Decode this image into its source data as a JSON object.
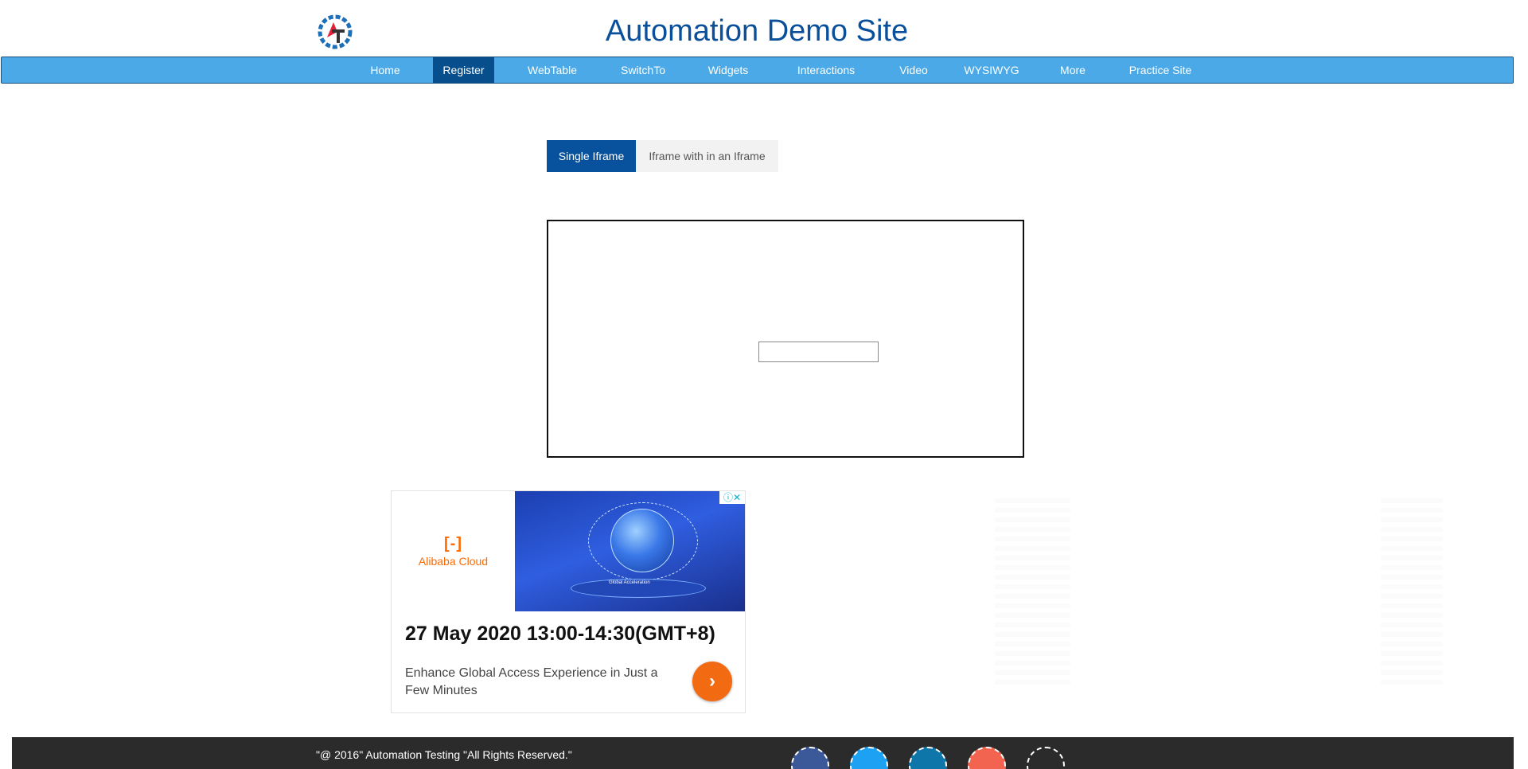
{
  "header": {
    "title": "Automation Demo Site",
    "logo_icon": "gear-at-logo-icon"
  },
  "nav": {
    "items": [
      {
        "label": "Home",
        "active": false
      },
      {
        "label": "Register",
        "active": true
      },
      {
        "label": "WebTable",
        "active": false
      },
      {
        "label": "SwitchTo",
        "active": false
      },
      {
        "label": "Widgets",
        "active": false
      },
      {
        "label": "Interactions",
        "active": false
      },
      {
        "label": "Video",
        "active": false
      },
      {
        "label": "WYSIWYG",
        "active": false
      },
      {
        "label": "More",
        "active": false
      },
      {
        "label": "Practice Site",
        "active": false
      }
    ]
  },
  "tabs": {
    "single": "Single Iframe",
    "nested": "Iframe with in an Iframe"
  },
  "iframe": {
    "input_value": ""
  },
  "ad": {
    "brand_mark": "[-]",
    "brand_name": "Alibaba Cloud",
    "platform_label": "Global Acceleration",
    "info_icon": "adchoices-info-icon",
    "info_text": "ⓘ✕",
    "headline": "27 May 2020 13:00-14:30(GMT+8)",
    "body": "Enhance Global Access Experience in Just a Few Minutes",
    "cta_icon": "chevron-right-icon",
    "cta_glyph": "›"
  },
  "footer": {
    "copyright": "\"@ 2016\" Automation Testing \"All Rights Reserved.\"",
    "social": [
      {
        "icon": "facebook-icon",
        "color": "#3b5998"
      },
      {
        "icon": "twitter-icon",
        "color": "#1da1f2"
      },
      {
        "icon": "linkedin-icon",
        "color": "#0e76a8"
      },
      {
        "icon": "google-plus-icon",
        "color": "#f26450"
      },
      {
        "icon": "youtube-icon",
        "color": "#2b2b2b"
      }
    ]
  },
  "colors": {
    "title": "#0a4f9a",
    "nav_bg": "#4aa9e6",
    "nav_active": "#064e8c",
    "tab_active": "#08519c",
    "footer_bg": "#2b2b2b",
    "cta": "#f26a12"
  }
}
